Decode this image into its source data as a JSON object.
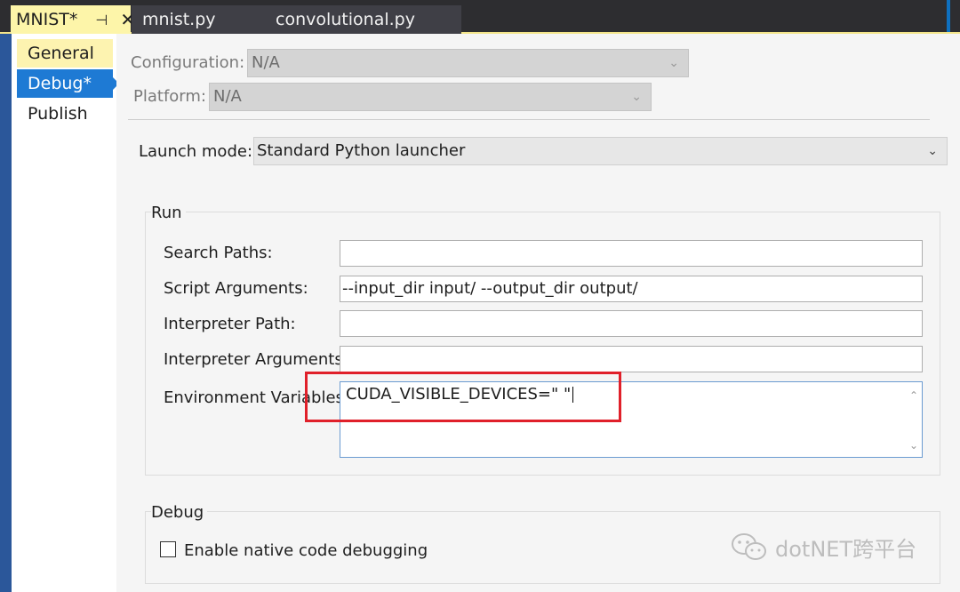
{
  "tabs": {
    "active": {
      "label": "MNIST*",
      "pin_glyph": "⊣",
      "close_glyph": "✕"
    },
    "others": [
      {
        "label": "mnist.py"
      },
      {
        "label": "convolutional.py"
      }
    ]
  },
  "sidebar": {
    "items": [
      {
        "label": "General"
      },
      {
        "label": "Debug*"
      },
      {
        "label": "Publish"
      }
    ]
  },
  "config": {
    "configuration_label": "Configuration:",
    "configuration_value": "N/A",
    "platform_label": "Platform:",
    "platform_value": "N/A"
  },
  "launch": {
    "label": "Launch mode:",
    "value": "Standard Python launcher"
  },
  "run": {
    "title": "Run",
    "search_paths_label": "Search Paths:",
    "search_paths_value": "",
    "script_args_label": "Script Arguments:",
    "script_args_value": "--input_dir input/ --output_dir output/",
    "interpreter_path_label": "Interpreter Path:",
    "interpreter_path_value": "",
    "interpreter_args_label": "Interpreter Arguments:",
    "interpreter_args_value": "",
    "env_vars_label": "Environment Variables:",
    "env_vars_value": "CUDA_VISIBLE_DEVICES=\" \""
  },
  "debug": {
    "title": "Debug",
    "native_label": "Enable native code debugging",
    "native_checked": false
  },
  "watermark": {
    "text": "dotNET跨平台",
    "icon": "wechat-icon"
  },
  "colors": {
    "accent": "#1e7ad4",
    "tab_active": "#fdf5a9",
    "highlight_box": "#e0202a"
  }
}
